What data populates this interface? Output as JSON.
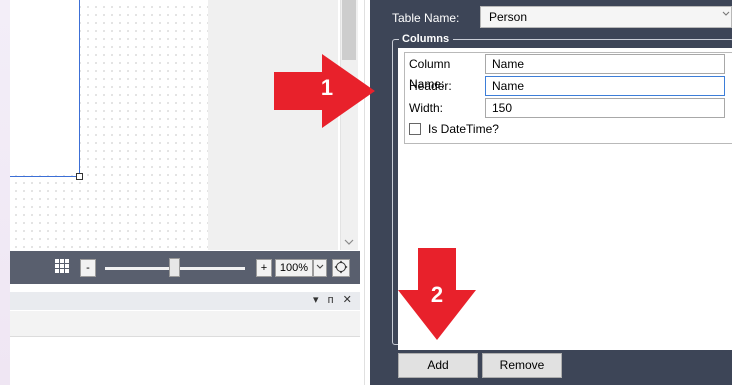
{
  "designer": {
    "zoom": {
      "minus_label": "-",
      "plus_label": "+",
      "value": "100%",
      "dropdown_icon": "chevron-down-icon",
      "slider_level_fraction": 0.5
    },
    "scrollbar_down_icon": "chevron-down-icon"
  },
  "bottom_panel": {
    "tool_icons": "▾ ᴨ ✕"
  },
  "properties": {
    "table_name_label": "Table Name:",
    "table_name_value": "Person",
    "columns_legend": "Columns",
    "fields": [
      {
        "label": "Column Name:",
        "value": "Name"
      },
      {
        "label": "Header:",
        "value": "Name"
      },
      {
        "label": "Width:",
        "value": "150"
      }
    ],
    "is_datetime_label": "Is DateTime?",
    "is_datetime_checked": false,
    "add_label": "Add",
    "remove_label": "Remove"
  },
  "annotations": [
    {
      "number": "1",
      "color": "#e8212b"
    },
    {
      "number": "2",
      "color": "#e8212b"
    }
  ]
}
